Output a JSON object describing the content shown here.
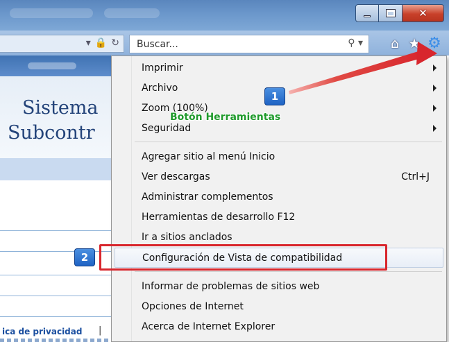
{
  "toolbar": {
    "search_placeholder": "Buscar...",
    "search_icon": "search-icon",
    "home_icon": "home-icon",
    "favorites_icon": "star-icon",
    "tools_icon": "gear-icon"
  },
  "window": {
    "minimize_label": "minimize",
    "maximize_label": "maximize",
    "close_label": "close"
  },
  "page": {
    "title_line1": "Sistema",
    "title_line2": "Subcontr",
    "footer_link": "ica de privacidad",
    "footer_separator": "|"
  },
  "menu": {
    "items": [
      {
        "label": "Imprimir",
        "submenu": true
      },
      {
        "label": "Archivo",
        "submenu": true
      },
      {
        "label": "Zoom (100%)",
        "submenu": true
      },
      {
        "label": "Seguridad",
        "submenu": true
      },
      {
        "label": "Agregar sitio al menú Inicio"
      },
      {
        "label": "Ver descargas",
        "shortcut": "Ctrl+J"
      },
      {
        "label": "Administrar complementos"
      },
      {
        "label": "Herramientas de desarrollo F12"
      },
      {
        "label": "Ir a sitios anclados"
      },
      {
        "label": "Configuración de Vista de compatibilidad",
        "highlighted": true
      },
      {
        "label": "Informar de problemas de sitios web"
      },
      {
        "label": "Opciones de Internet"
      },
      {
        "label": "Acerca de Internet Explorer"
      }
    ]
  },
  "annotations": {
    "badge1": "1",
    "badge2": "2",
    "callout": "Botón Herramientas",
    "arrow_color": "#d8262d",
    "box_color": "#d8262d",
    "callout_color": "#1f9a2c"
  }
}
